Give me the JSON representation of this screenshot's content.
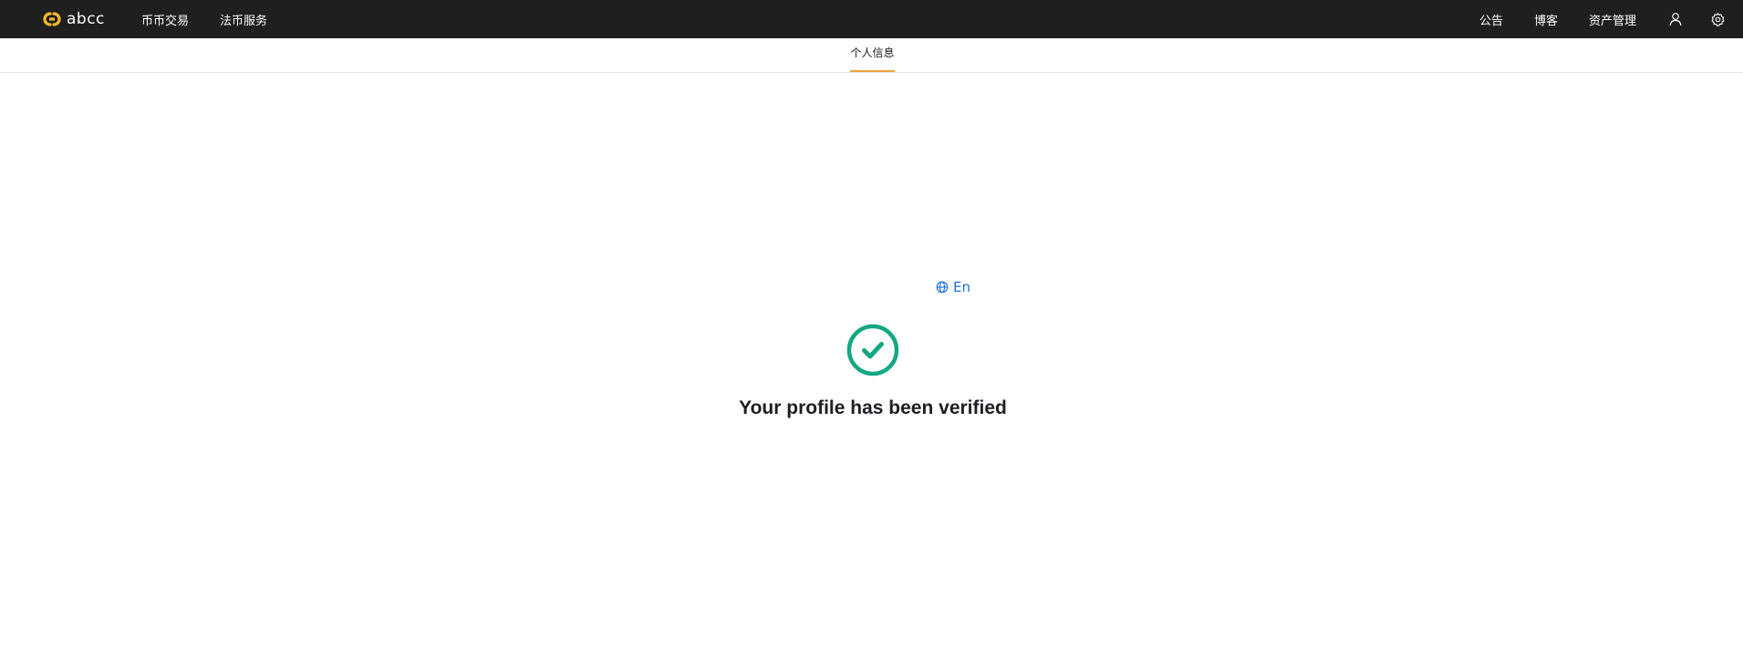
{
  "header": {
    "logo_text": "abcc",
    "nav_left": [
      {
        "label": "币币交易"
      },
      {
        "label": "法币服务"
      }
    ],
    "nav_right": [
      {
        "label": "公告"
      },
      {
        "label": "博客"
      },
      {
        "label": "资产管理"
      }
    ],
    "icons": [
      "user-icon",
      "settings-icon"
    ]
  },
  "tabs": {
    "active_label": "个人信息"
  },
  "content": {
    "language_label": "En",
    "message": "Your profile has been verified"
  },
  "colors": {
    "topbar": "#1f1f1f",
    "logo": "#f5b82a",
    "tab_accent": "#f0a23b",
    "link": "#1a6fd6",
    "success": "#13a883",
    "text": "#1d1f25"
  }
}
